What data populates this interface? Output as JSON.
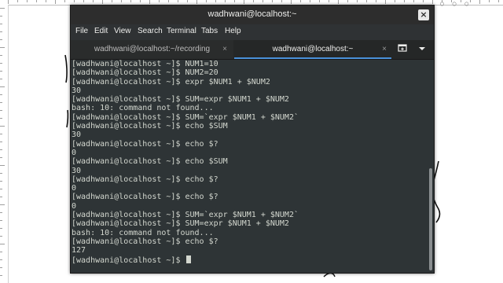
{
  "window": {
    "title": "wadhwani@localhost:~",
    "close_glyph": "×"
  },
  "menu": [
    "File",
    "Edit",
    "View",
    "Search",
    "Terminal",
    "Tabs",
    "Help"
  ],
  "tabs": [
    {
      "label": "wadhwani@localhost:~/recording",
      "close_glyph": "×",
      "active": false
    },
    {
      "label": "wadhwani@localhost:~",
      "close_glyph": "×",
      "active": true
    }
  ],
  "toolbar": {
    "new_tab_icon": "new-tab-icon",
    "tabs_menu_icon": "chevron-down-icon"
  },
  "terminal": {
    "lines": [
      "[wadhwani@localhost ~]$ NUM1=10",
      "[wadhwani@localhost ~]$ NUM2=20",
      "[wadhwani@localhost ~]$ expr $NUM1 + $NUM2",
      "30",
      "[wadhwani@localhost ~]$ SUM=expr $NUM1 + $NUM2",
      "bash: 10: command not found...",
      "[wadhwani@localhost ~]$ SUM=`expr $NUM1 + $NUM2`",
      "[wadhwani@localhost ~]$ echo $SUM",
      "30",
      "[wadhwani@localhost ~]$ echo $?",
      "0",
      "[wadhwani@localhost ~]$ echo $SUM",
      "30",
      "[wadhwani@localhost ~]$ echo $?",
      "0",
      "[wadhwani@localhost ~]$ echo $?",
      "0",
      "[wadhwani@localhost ~]$ SUM=`expr $NUM1 + $NUM2`",
      "[wadhwani@localhost ~]$ SUM=expr $NUM1 + $NUM2",
      "bash: 10: command not found...",
      "[wadhwani@localhost ~]$ echo $?",
      "127"
    ],
    "prompt": "[wadhwani@localhost ~]$ "
  },
  "colors": {
    "terminal_bg": "#2e3436",
    "terminal_fg": "#d3d7cf",
    "active_tab_accent": "#4a90d9"
  }
}
